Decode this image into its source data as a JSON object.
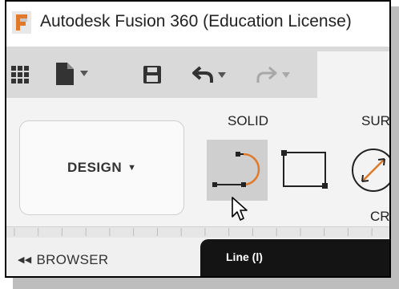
{
  "window": {
    "title": "Autodesk Fusion 360 (Education License)",
    "logo_icon": "fusion-logo-icon"
  },
  "quick_access": {
    "items": [
      {
        "name": "apps-grid",
        "icon": "grid-icon"
      },
      {
        "name": "file-menu",
        "icon": "file-icon"
      },
      {
        "name": "save",
        "icon": "save-icon"
      },
      {
        "name": "undo",
        "icon": "undo-icon"
      },
      {
        "name": "redo",
        "icon": "redo-icon",
        "enabled": false
      }
    ]
  },
  "workspace": {
    "selected": "DESIGN",
    "dropdown_symbol": "▼"
  },
  "ribbon": {
    "tab_solid": "SOLID",
    "tab_surface_partial": "SURI",
    "group_create_partial": "CRI",
    "tools": [
      {
        "name": "line",
        "icon": "line-arc-icon",
        "highlighted": true
      },
      {
        "name": "rectangle",
        "icon": "rectangle-icon"
      },
      {
        "name": "circle",
        "icon": "circle-icon"
      }
    ]
  },
  "browser": {
    "collapse_symbol": "◀◀",
    "label": "BROWSER"
  },
  "tooltip": {
    "text": "Line (l)"
  },
  "colors": {
    "title_bg": "#ffffff",
    "toolbar_bg": "#d9d9d9",
    "ribbon_bg": "#f3f3f3",
    "tool_highlight": "#cfcfcf",
    "tooltip_bg": "#141414",
    "logo_orange": "#e07a2a"
  }
}
